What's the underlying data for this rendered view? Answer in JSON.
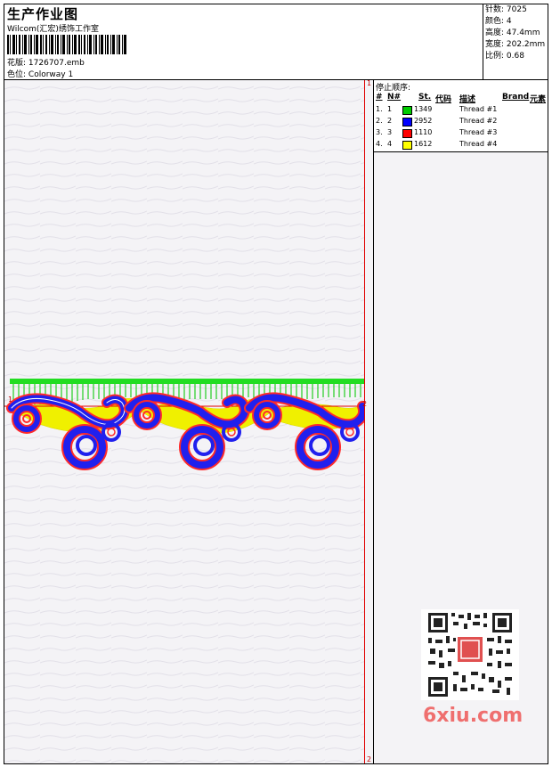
{
  "header": {
    "title": "生产作业图",
    "company": "Wilcom(汇宏)绣饰工作室",
    "design_label": "花版:",
    "design_value": "1726707.emb",
    "colorway_label": "色位:",
    "colorway_value": "Colorway 1"
  },
  "stats": {
    "stitches": "针数: 7025",
    "colors": "颜色: 4",
    "height": "高度: 47.4mm",
    "width": "宽度: 202.2mm",
    "scale": "比例: 0.68"
  },
  "markers": {
    "top": "1",
    "bottom": "2",
    "left_mid": "1",
    "right_mid": "2"
  },
  "stop_sequence": {
    "title": "停止顺序:",
    "headers": {
      "hash": "#",
      "n": "N#",
      "st": "St.",
      "code": "代码",
      "desc": "描述",
      "brand": "Brand",
      "element": "元素"
    },
    "rows": [
      {
        "idx": "1.",
        "n": "1",
        "code": "1349",
        "desc": "Thread #1",
        "color": "#00cc00"
      },
      {
        "idx": "2.",
        "n": "2",
        "code": "2952",
        "desc": "Thread #2",
        "color": "#0000ff"
      },
      {
        "idx": "3.",
        "n": "3",
        "code": "1110",
        "desc": "Thread #3",
        "color": "#ff0000"
      },
      {
        "idx": "4.",
        "n": "4",
        "code": "1612",
        "desc": "Thread #4",
        "color": "#ffff00"
      }
    ]
  },
  "watermark": {
    "logo_text": "6xiu.com"
  }
}
